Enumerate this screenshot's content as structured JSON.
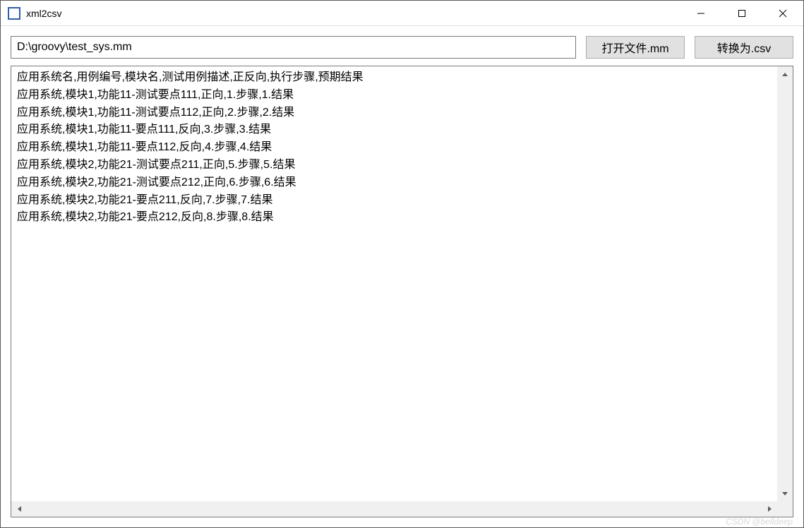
{
  "window": {
    "title": "xml2csv"
  },
  "toolbar": {
    "path_value": "D:\\groovy\\test_sys.mm",
    "open_button_label": "打开文件.mm",
    "convert_button_label": "转换为.csv"
  },
  "output": {
    "lines": [
      "应用系统名,用例编号,模块名,测试用例描述,正反向,执行步骤,预期结果",
      "应用系统,模块1,功能11-测试要点111,正向,1.步骤,1.结果",
      "应用系统,模块1,功能11-测试要点112,正向,2.步骤,2.结果",
      "应用系统,模块1,功能11-要点111,反向,3.步骤,3.结果",
      "应用系统,模块1,功能11-要点112,反向,4.步骤,4.结果",
      "应用系统,模块2,功能21-测试要点211,正向,5.步骤,5.结果",
      "应用系统,模块2,功能21-测试要点212,正向,6.步骤,6.结果",
      "应用系统,模块2,功能21-要点211,反向,7.步骤,7.结果",
      "应用系统,模块2,功能21-要点212,反向,8.步骤,8.结果"
    ]
  },
  "watermark": "CSDN @belldeep"
}
